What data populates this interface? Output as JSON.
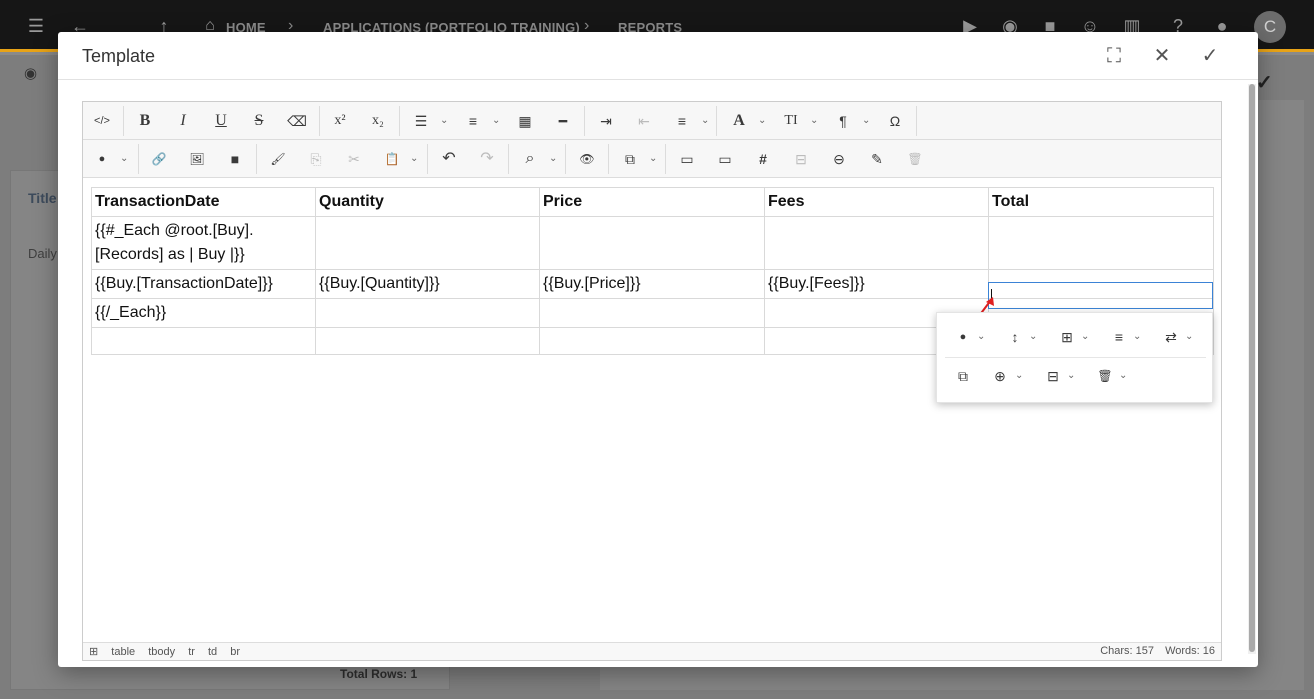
{
  "app": {
    "breadcrumbs": [
      "HOME",
      "APPLICATIONS (PORTFOLIO TRAINING)",
      "REPORTS"
    ],
    "avatar_initial": "C",
    "background": {
      "title_tab": "Title",
      "list_item": "Daily",
      "total_rows": "Total Rows: 1"
    }
  },
  "dialog": {
    "title": "Template"
  },
  "toolbar": {
    "row1": [
      {
        "name": "code-view",
        "glyph": "</>"
      },
      {
        "name": "bold",
        "glyph": "B"
      },
      {
        "name": "italic",
        "glyph": "I"
      },
      {
        "name": "underline",
        "glyph": "U"
      },
      {
        "name": "strikethrough",
        "glyph": "S"
      },
      {
        "name": "clear-format",
        "glyph": "⌫"
      },
      {
        "name": "superscript",
        "glyph": "x²"
      },
      {
        "name": "subscript",
        "glyph": "x₂"
      },
      {
        "name": "bullet-list",
        "glyph": "☰"
      },
      {
        "name": "numbered-list",
        "glyph": "≡"
      },
      {
        "name": "insert-table",
        "glyph": "▦"
      },
      {
        "name": "horizontal-line",
        "glyph": "━"
      },
      {
        "name": "indent",
        "glyph": "⇥"
      },
      {
        "name": "outdent",
        "glyph": "⇤"
      },
      {
        "name": "align",
        "glyph": "≡"
      },
      {
        "name": "font-color",
        "glyph": "A"
      },
      {
        "name": "font-size",
        "glyph": "TI"
      },
      {
        "name": "paragraph",
        "glyph": "¶"
      },
      {
        "name": "special-char",
        "glyph": "Ω"
      }
    ],
    "row2": [
      {
        "name": "highlight",
        "glyph": "●"
      },
      {
        "name": "link",
        "glyph": "🔗"
      },
      {
        "name": "image",
        "glyph": "🖼"
      },
      {
        "name": "video",
        "glyph": "■"
      },
      {
        "name": "format-painter",
        "glyph": "🖌"
      },
      {
        "name": "copy",
        "glyph": "⎘"
      },
      {
        "name": "cut",
        "glyph": "✂"
      },
      {
        "name": "paste",
        "glyph": "📋"
      },
      {
        "name": "undo",
        "glyph": "↶"
      },
      {
        "name": "redo",
        "glyph": "↷"
      },
      {
        "name": "find",
        "glyph": "⌕"
      },
      {
        "name": "preview",
        "glyph": "👁"
      },
      {
        "name": "select-all",
        "glyph": "⧉"
      },
      {
        "name": "header",
        "glyph": "▭"
      },
      {
        "name": "footer",
        "glyph": "▭"
      },
      {
        "name": "page-number",
        "glyph": "#"
      },
      {
        "name": "page-break",
        "glyph": "⊟"
      },
      {
        "name": "strike-block",
        "glyph": "⊖"
      },
      {
        "name": "edit",
        "glyph": "✎"
      },
      {
        "name": "delete",
        "glyph": "🗑"
      }
    ]
  },
  "table": {
    "headers": [
      "TransactionDate",
      "Quantity",
      "Price",
      "Fees",
      "Total"
    ],
    "rows": [
      [
        "{{#_Each @root.[Buy].[Records] as | Buy |}}",
        "",
        "",
        "",
        ""
      ],
      [
        "{{Buy.[TransactionDate]}}",
        "{{Buy.[Quantity]}}",
        "{{Buy.[Price]}}",
        "{{Buy.[Fees]}}",
        ""
      ],
      [
        "{{/_Each}}",
        "",
        "",
        "",
        ""
      ],
      [
        "",
        "",
        "",
        "",
        ""
      ]
    ]
  },
  "popup": {
    "row1": [
      "cell-color",
      "row-height",
      "cell-borders",
      "cell-align",
      "swap"
    ],
    "row2": [
      "merge-cells",
      "insert",
      "delete-column",
      "delete-row"
    ]
  },
  "status": {
    "path": [
      "table",
      "tbody",
      "tr",
      "td",
      "br"
    ],
    "chars": "Chars: 157",
    "words": "Words: 16"
  },
  "colors": {
    "accent_bar": "#e8a317",
    "selection": "#3b83d6",
    "arrow": "#e02020"
  }
}
